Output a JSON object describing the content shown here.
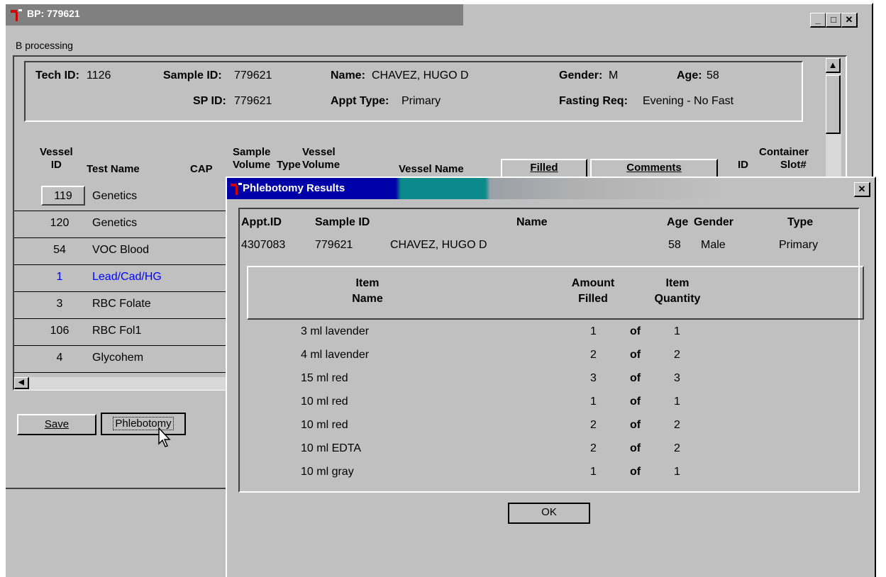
{
  "main_window": {
    "title": "BP: 779621",
    "menu": "B processing",
    "header": {
      "tech_id_label": "Tech ID:",
      "tech_id": "1126",
      "sample_id_label": "Sample ID:",
      "sample_id": "779621",
      "name_label": "Name:",
      "name": "CHAVEZ, HUGO D",
      "gender_label": "Gender:",
      "gender": "M",
      "age_label": "Age:",
      "age": "58",
      "sp_id_label": "SP ID:",
      "sp_id": "779621",
      "appt_type_label": "Appt Type:",
      "appt_type": "Primary",
      "fasting_label": "Fasting Req:",
      "fasting": "Evening - No Fast"
    },
    "columns": {
      "vessel_id_1": "Vessel",
      "vessel_id_2": "ID",
      "test_name": "Test Name",
      "cap": "CAP",
      "sample_1": "Sample",
      "sample_2": "Volume",
      "type": "Type",
      "vessel_vol_1": "Vessel",
      "vessel_vol_2": "Volume",
      "vessel_name": "Vessel Name",
      "filled": "Filled",
      "comments": "Comments",
      "container_1": "Container",
      "container_id": "ID",
      "slot": "Slot#"
    },
    "rows": [
      {
        "id": "119",
        "test": "Genetics"
      },
      {
        "id": "120",
        "test": "Genetics"
      },
      {
        "id": "54",
        "test": "VOC Blood"
      },
      {
        "id": "1",
        "test": "Lead/Cad/HG"
      },
      {
        "id": "3",
        "test": "RBC Folate"
      },
      {
        "id": "106",
        "test": "RBC Fol1"
      },
      {
        "id": "4",
        "test": "Glycohem"
      }
    ],
    "save_button": "Save",
    "phlebotomy_button": "Phlebotomy"
  },
  "dialog": {
    "title": "Phlebotomy Results",
    "headers": {
      "appt_id": "Appt.ID",
      "sample_id": "Sample ID",
      "name": "Name",
      "age": "Age",
      "gender": "Gender",
      "type": "Type"
    },
    "info": {
      "appt_id": "4307083",
      "sample_id": "779621",
      "name": "CHAVEZ, HUGO D",
      "age": "58",
      "gender": "Male",
      "type": "Primary"
    },
    "columns": {
      "item_1": "Item",
      "item_2": "Name",
      "amount_1": "Amount",
      "amount_2": "Filled",
      "qty_1": "Item",
      "qty_2": "Quantity"
    },
    "items": [
      {
        "name": "3 ml lavender",
        "filled": "1",
        "of": "of",
        "qty": "1"
      },
      {
        "name": "4 ml lavender",
        "filled": "2",
        "of": "of",
        "qty": "2"
      },
      {
        "name": "15 ml red",
        "filled": "3",
        "of": "of",
        "qty": "3"
      },
      {
        "name": "10 ml red",
        "filled": "1",
        "of": "of",
        "qty": "1"
      },
      {
        "name": "10 ml red",
        "filled": "2",
        "of": "of",
        "qty": "2"
      },
      {
        "name": "10 ml EDTA",
        "filled": "2",
        "of": "of",
        "qty": "2"
      },
      {
        "name": "10 ml gray",
        "filled": "1",
        "of": "of",
        "qty": "1"
      }
    ],
    "ok_button": "OK"
  }
}
